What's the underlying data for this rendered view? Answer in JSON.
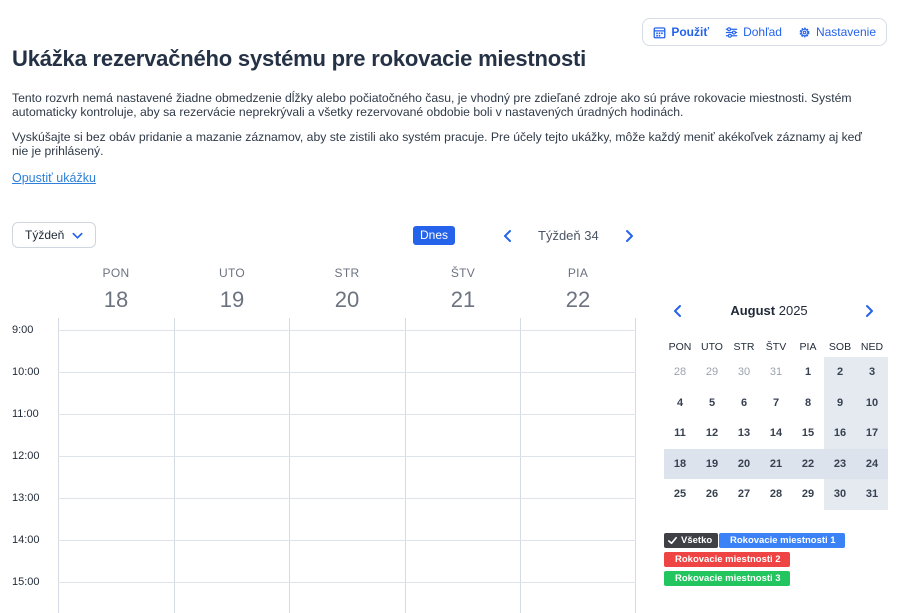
{
  "toolbar": {
    "use_label": "Použiť",
    "supervise_label": "Dohľad",
    "settings_label": "Nastavenie"
  },
  "page": {
    "title": "Ukážka rezervačného systému pre rokovacie miestnosti",
    "paragraph1": "Tento rozvrh nemá nastavené žiadne obmedzenie dĺžky alebo počiatočného času, je vhodný pre zdieľané zdroje ako sú práve rokovacie miestnosti. Systém automaticky kontroluje, aby sa rezervácie neprekrývali a všetky rezervované obdobie boli v nastavených úradných hodinách.",
    "paragraph2": "Vyskúšajte si bez obáv pridanie a mazanie záznamov, aby ste zistili ako systém pracuje. Pre účely tejto ukážky, môže každý meniť akékoľvek záznamy aj keď nie je prihlásený.",
    "leave_link": "Opustiť ukážku"
  },
  "calendar": {
    "view_select": "Týždeň",
    "today_button": "Dnes",
    "week_label": "Týždeň 34",
    "days": [
      {
        "name": "PON",
        "date": "18"
      },
      {
        "name": "UTO",
        "date": "19"
      },
      {
        "name": "STR",
        "date": "20"
      },
      {
        "name": "ŠTV",
        "date": "21"
      },
      {
        "name": "PIA",
        "date": "22"
      }
    ],
    "hours": [
      "9:00",
      "10:00",
      "11:00",
      "12:00",
      "13:00",
      "14:00",
      "15:00"
    ]
  },
  "mini_calendar": {
    "month": "August",
    "year": "2025",
    "weekdays": [
      "PON",
      "UTO",
      "STR",
      "ŠTV",
      "PIA",
      "SOB",
      "NED"
    ],
    "weeks": [
      [
        "28",
        "29",
        "30",
        "31",
        "1",
        "2",
        "3"
      ],
      [
        "4",
        "5",
        "6",
        "7",
        "8",
        "9",
        "10"
      ],
      [
        "11",
        "12",
        "13",
        "14",
        "15",
        "16",
        "17"
      ],
      [
        "18",
        "19",
        "20",
        "21",
        "22",
        "23",
        "24"
      ],
      [
        "25",
        "26",
        "27",
        "28",
        "29",
        "30",
        "31"
      ]
    ]
  },
  "legend": {
    "all": "Všetko",
    "room1": "Rokovacie miestnosti 1",
    "room2": "Rokovacie miestnosti 2",
    "room3": "Rokovacie miestnosti 3"
  },
  "colors": {
    "accent": "#2563eb",
    "room1": "#3b82f6",
    "room2": "#ef4444",
    "room3": "#22c55e",
    "all": "#3f3f46"
  }
}
